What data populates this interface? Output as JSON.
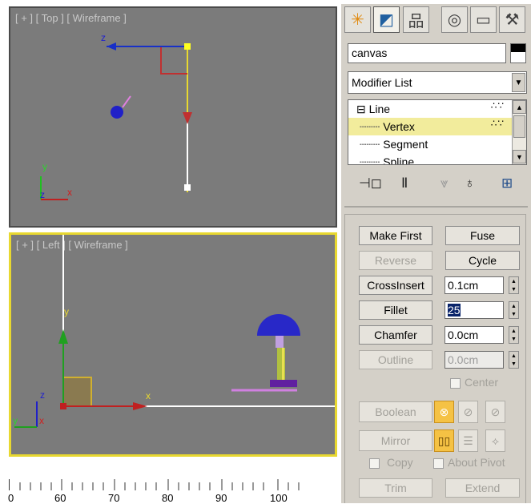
{
  "viewports": {
    "top_label": "[ + ] [ Top ] [ Wireframe ]",
    "left_label": "[ + ] [ Left ] [ Wireframe ]",
    "top_axis": {
      "z": "z",
      "y": "y",
      "x": "x"
    },
    "left_axis": {
      "z": "z",
      "y": "y",
      "x": "x"
    }
  },
  "ruler": {
    "labels": [
      "0",
      "60",
      "70",
      "80",
      "90",
      "100"
    ]
  },
  "command_panel": {
    "tabs": [
      {
        "name": "create-tab-icon",
        "glyph": "✳"
      },
      {
        "name": "modify-tab-icon",
        "glyph": "◩"
      },
      {
        "name": "hierarchy-tab-icon",
        "glyph": "品"
      },
      {
        "name": "motion-tab-icon",
        "glyph": "◎"
      },
      {
        "name": "display-tab-icon",
        "glyph": "▭"
      },
      {
        "name": "utilities-tab-icon",
        "glyph": "⚒"
      }
    ],
    "object_name": "canvas",
    "object_color": "#000000",
    "modifier_list_label": "Modifier List",
    "stack": {
      "items": [
        {
          "label": "Line",
          "prefix": "⊟ "
        },
        {
          "label": "Vertex",
          "prefix": ""
        },
        {
          "label": "Segment",
          "prefix": ""
        },
        {
          "label": "Spline",
          "prefix": ""
        }
      ]
    },
    "stack_tools": [
      {
        "name": "pin-stack-icon",
        "glyph": "⊣◻"
      },
      {
        "name": "show-end-result-icon",
        "glyph": "Ⅱ"
      },
      {
        "name": "make-unique-icon",
        "glyph": "⩔"
      },
      {
        "name": "remove-modifier-icon",
        "glyph": "♁"
      },
      {
        "name": "configure-modifier-sets-icon",
        "glyph": "⊞"
      }
    ],
    "geometry": {
      "make_first": "Make First",
      "fuse": "Fuse",
      "reverse": "Reverse",
      "cycle": "Cycle",
      "cross_insert": "CrossInsert",
      "cross_insert_value": "0.1cm",
      "fillet": "Fillet",
      "fillet_value": "25",
      "chamfer": "Chamfer",
      "chamfer_value": "0.0cm",
      "outline": "Outline",
      "outline_value": "0.0cm",
      "center": "Center",
      "boolean": "Boolean",
      "mirror": "Mirror",
      "copy": "Copy",
      "about_pivot": "About Pivot",
      "trim": "Trim",
      "extend": "Extend"
    },
    "accent_color": "#f5c244"
  }
}
